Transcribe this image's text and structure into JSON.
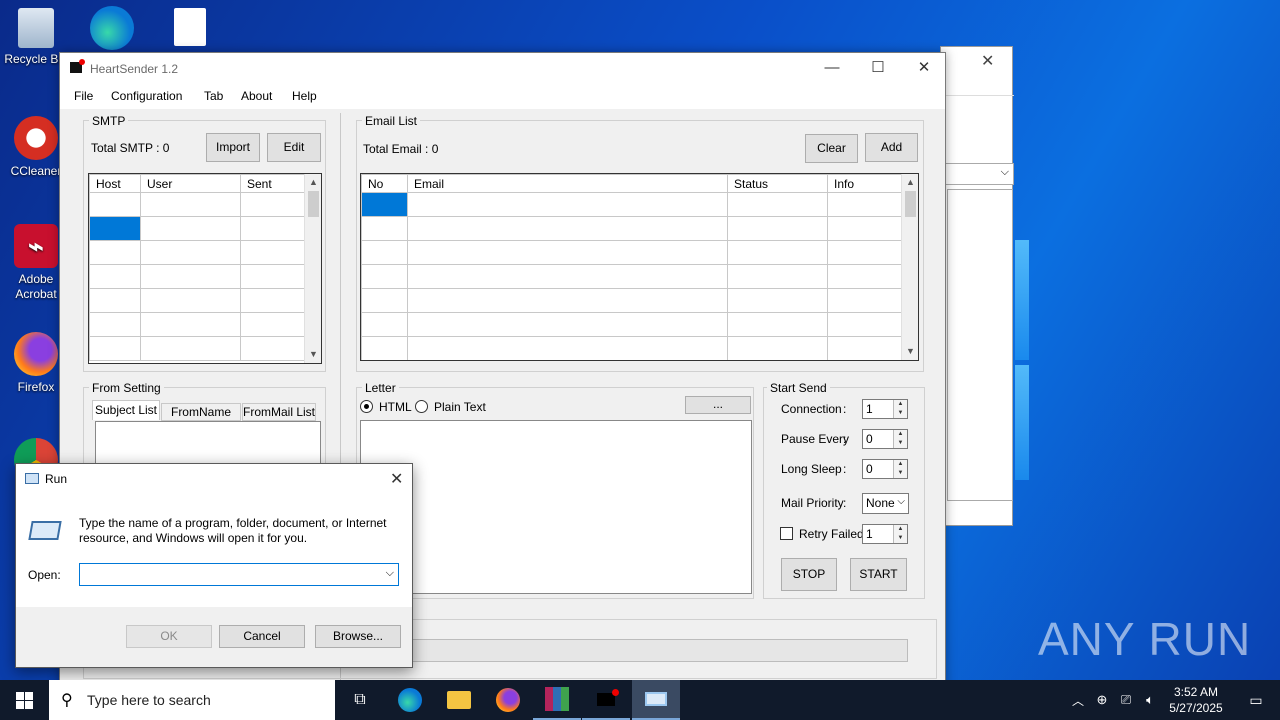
{
  "desktop": {
    "icons": [
      {
        "label": "Recycle Bin"
      },
      {
        "label": "CCleaner"
      },
      {
        "label": "Adobe Acrobat"
      },
      {
        "label": "Firefox"
      }
    ],
    "watermark": "ANY RUN"
  },
  "window": {
    "title": "HeartSender 1.2",
    "menu": [
      "File",
      "Configuration",
      "Tab",
      "About",
      "Help"
    ]
  },
  "smtp": {
    "group_label": "SMTP",
    "total": "Total SMTP : 0",
    "import_label": "Import",
    "edit_label": "Edit",
    "columns": [
      "Host",
      "User",
      "Sent"
    ]
  },
  "email_list": {
    "group_label": "Email List",
    "total": "Total Email : 0",
    "clear_label": "Clear",
    "add_label": "Add",
    "columns": [
      "No",
      "Email",
      "Status",
      "Info"
    ]
  },
  "from_setting": {
    "group_label": "From Setting",
    "tabs": [
      "Subject List",
      "FromName List",
      "FromMail List"
    ]
  },
  "letter": {
    "group_label": "Letter",
    "html_label": "HTML",
    "plain_label": "Plain Text",
    "browse_label": "..."
  },
  "start_send": {
    "group_label": "Start Send",
    "connection_label": "Connection",
    "connection_value": "1",
    "pause_label": "Pause Every",
    "pause_value": "0",
    "sleep_label": "Long Sleep",
    "sleep_value": "0",
    "priority_label": "Mail Priority",
    "priority_value": "None",
    "retry_label": "Retry Failed",
    "retry_value": "1",
    "stop_label": "STOP",
    "start_label": "START"
  },
  "run_dialog": {
    "title": "Run",
    "description": "Type the name of a program, folder, document, or Internet resource, and Windows will open it for you.",
    "open_label": "Open:",
    "open_value": "",
    "ok_label": "OK",
    "cancel_label": "Cancel",
    "browse_label": "Browse..."
  },
  "taskbar": {
    "search_placeholder": "Type here to search",
    "time": "3:52 AM",
    "date": "5/27/2025"
  },
  "colors": {
    "selection": "#0078d7",
    "taskbar": "#101a2b"
  }
}
